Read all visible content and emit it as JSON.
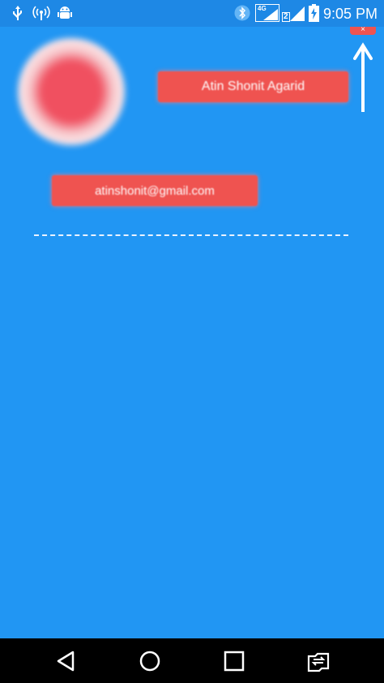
{
  "status_bar": {
    "time": "9:05 PM",
    "network_label": "4G",
    "sim_label": "2",
    "icons": [
      "usb-icon",
      "wifi-hotspot-icon",
      "android-debug-icon",
      "bluetooth-icon",
      "sim1-signal-icon",
      "sim2-signal-icon",
      "battery-charging-icon"
    ]
  },
  "profile": {
    "name": "Atin Shonit Agarid",
    "email": "atinshonit@gmail.com"
  },
  "close_button": {
    "label": "×"
  },
  "nav_bar": {
    "buttons": [
      "back-icon",
      "home-icon",
      "recents-icon",
      "switch-sim-icon"
    ]
  },
  "colors": {
    "background": "#2196F3",
    "status_bar": "#1E88E5",
    "highlight": "#EF5350"
  }
}
